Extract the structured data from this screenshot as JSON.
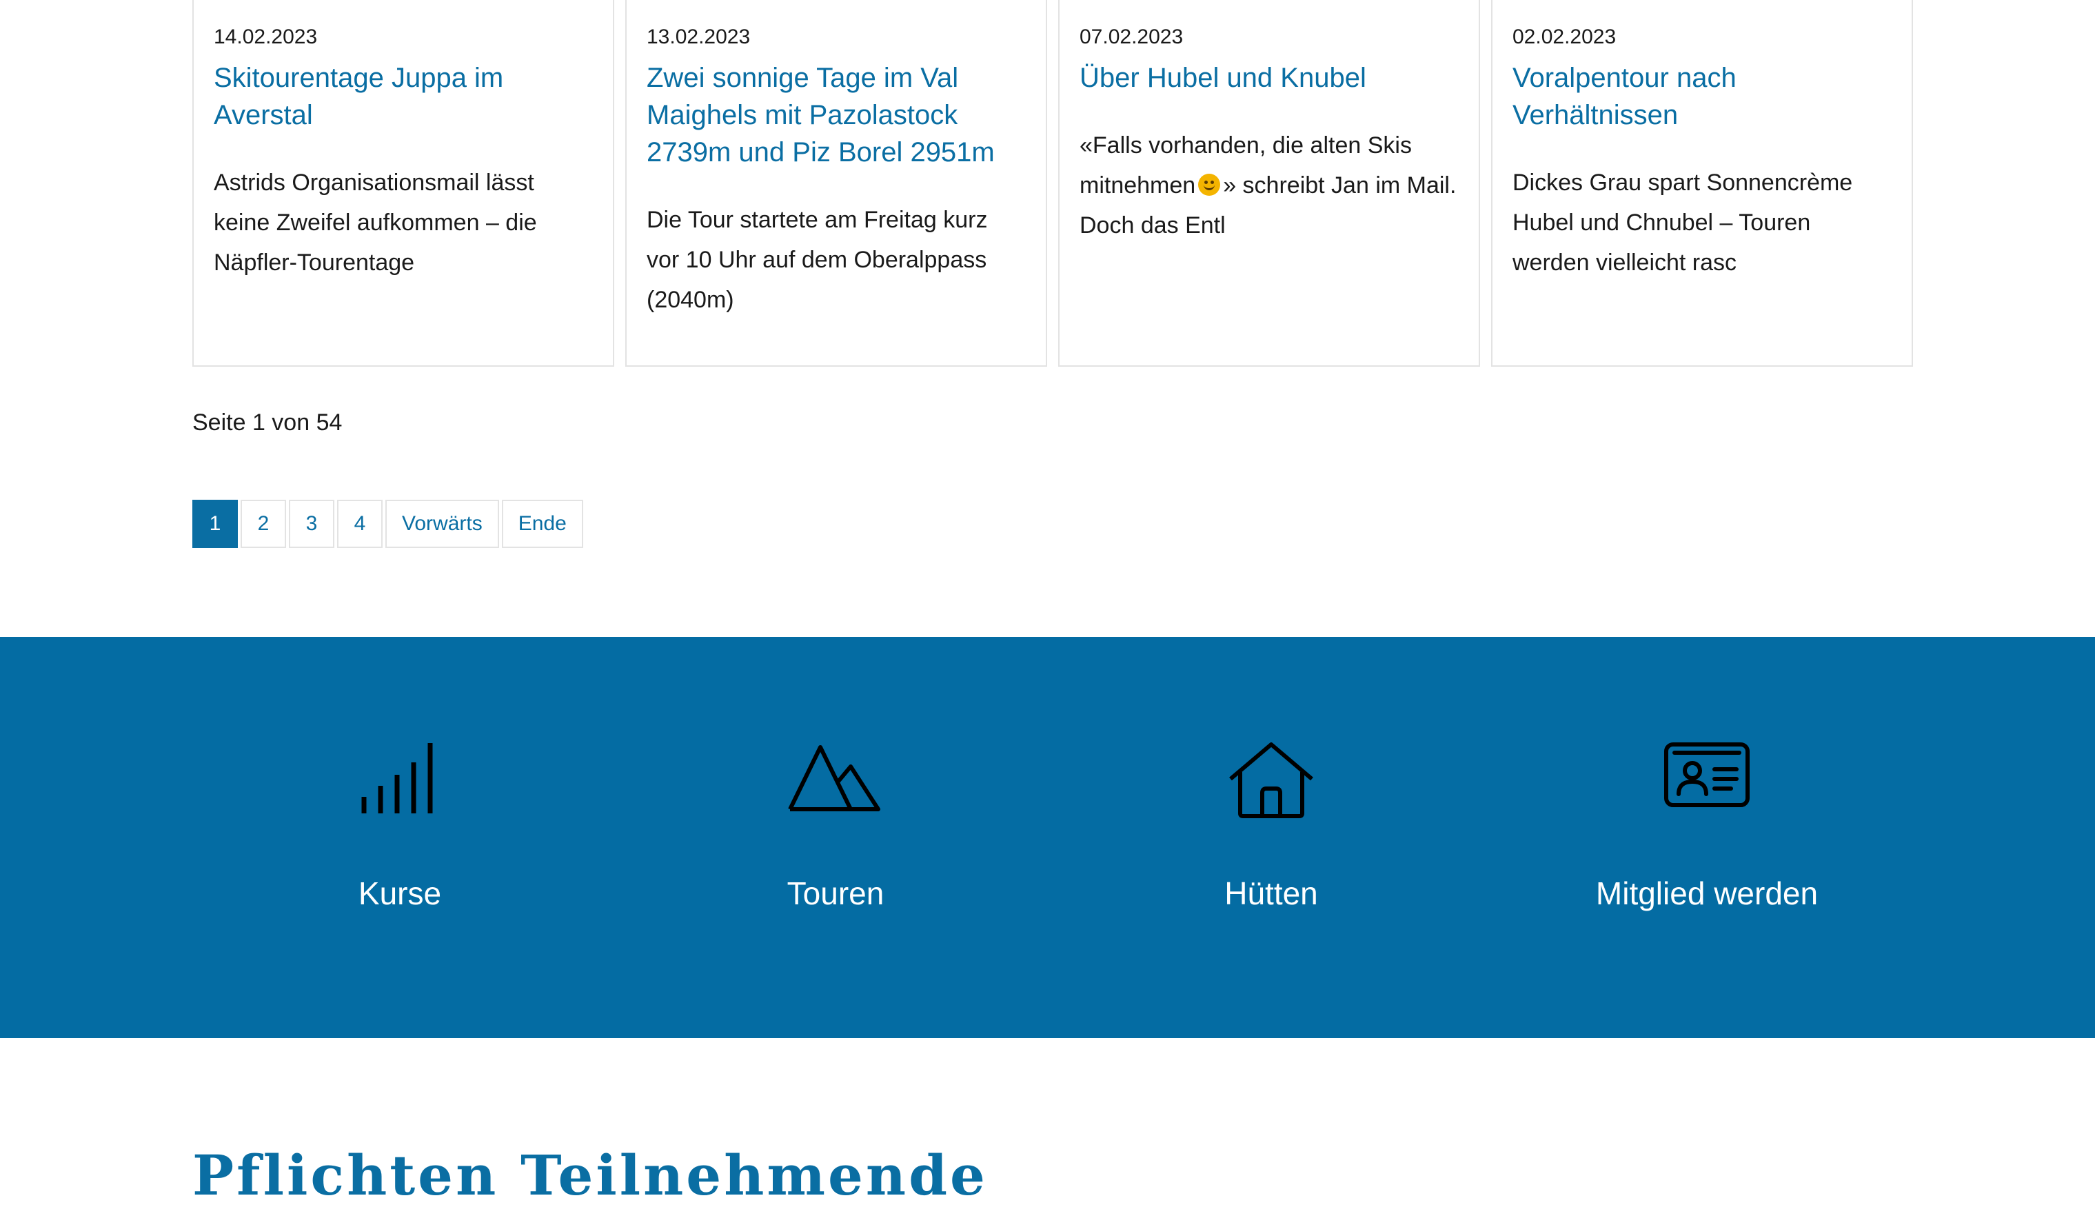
{
  "posts": [
    {
      "date": "14.02.2023",
      "title": "Skitourentage Juppa im Averstal",
      "excerpt": "Astrids Organisationsmail lässt keine Zweifel aufkommen – die Näpfler-Tourentage"
    },
    {
      "date": "13.02.2023",
      "title": "Zwei sonnige Tage im Val Maighels mit Pazolastock 2739m und Piz Borel 2951m",
      "excerpt": "Die Tour startete am Freitag kurz vor 10 Uhr auf dem Oberalppass (2040m)"
    },
    {
      "date": "07.02.2023",
      "title": "Über Hubel und Knubel",
      "excerpt_before": "«Falls vorhanden, die alten Skis mitnehmen",
      "excerpt_after": "» schreibt Jan im Mail. Doch das Entl",
      "emoji_icon": "smiling-face-icon"
    },
    {
      "date": "02.02.2023",
      "title": "Voralpentour nach Verhältnissen",
      "excerpt": "Dickes Grau spart Sonnencrème Hubel und Chnubel – Touren werden vielleicht rasc"
    }
  ],
  "pagination": {
    "info": "Seite 1 von 54",
    "pages": [
      "1",
      "2",
      "3",
      "4"
    ],
    "current": "1",
    "next_label": "Vorwärts",
    "last_label": "Ende"
  },
  "features": [
    {
      "label": "Kurse",
      "icon": "signal-bars-icon"
    },
    {
      "label": "Touren",
      "icon": "mountain-icon"
    },
    {
      "label": "Hütten",
      "icon": "house-icon"
    },
    {
      "label": "Mitglied werden",
      "icon": "member-card-icon"
    }
  ],
  "section": {
    "title": "Pflichten Teilnehmende"
  },
  "colors": {
    "brand_blue": "#046ca3",
    "link_blue": "#0a6ea3",
    "border": "#e3e3e3"
  }
}
